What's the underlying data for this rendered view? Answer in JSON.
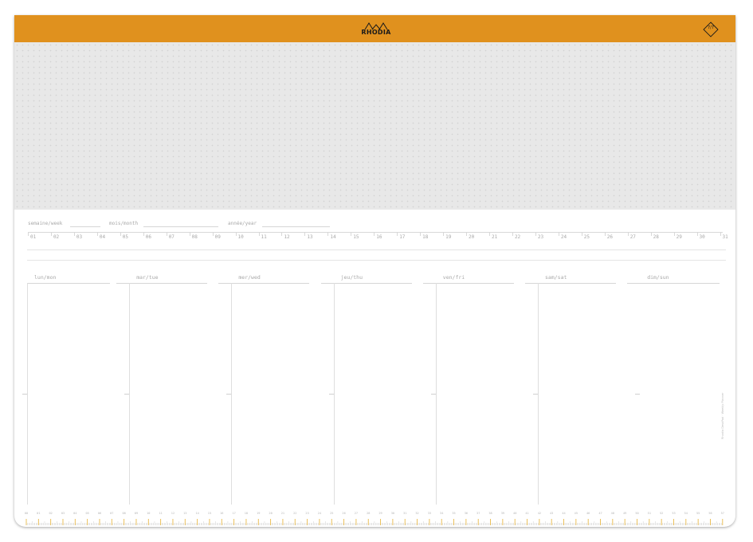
{
  "brand": {
    "name": "RHODIA",
    "badge": "7/7",
    "header_color": "#e0911e"
  },
  "meta": {
    "week_label": "semaine/week",
    "month_label": "mois/month",
    "year_label": "année/year"
  },
  "days_of_month": [
    "01",
    "02",
    "03",
    "04",
    "05",
    "06",
    "07",
    "08",
    "09",
    "10",
    "11",
    "12",
    "13",
    "14",
    "15",
    "16",
    "17",
    "18",
    "19",
    "20",
    "21",
    "22",
    "23",
    "24",
    "25",
    "26",
    "27",
    "28",
    "29",
    "30",
    "31"
  ],
  "weekdays": [
    "lun/mon",
    "mar/tue",
    "mer/wed",
    "jeu/thu",
    "ven/fri",
    "sam/sat",
    "dim/sun"
  ],
  "side_text": "Rhodia DeskPad · Weekly Planner",
  "ruler": {
    "labels": [
      "00",
      "01",
      "02",
      "03",
      "04",
      "05",
      "06",
      "07",
      "08",
      "09",
      "10",
      "11",
      "12",
      "13",
      "14",
      "15",
      "16",
      "17",
      "18",
      "19",
      "20",
      "21",
      "22",
      "23",
      "24",
      "25",
      "26",
      "27",
      "28",
      "29",
      "30",
      "31",
      "32",
      "33",
      "34",
      "35",
      "36",
      "37",
      "38",
      "39",
      "40",
      "41",
      "42",
      "43",
      "44",
      "45",
      "46",
      "47",
      "48",
      "49",
      "50",
      "51",
      "52",
      "53",
      "54",
      "55",
      "56",
      "57"
    ],
    "accent_color": "#e8b94a"
  }
}
